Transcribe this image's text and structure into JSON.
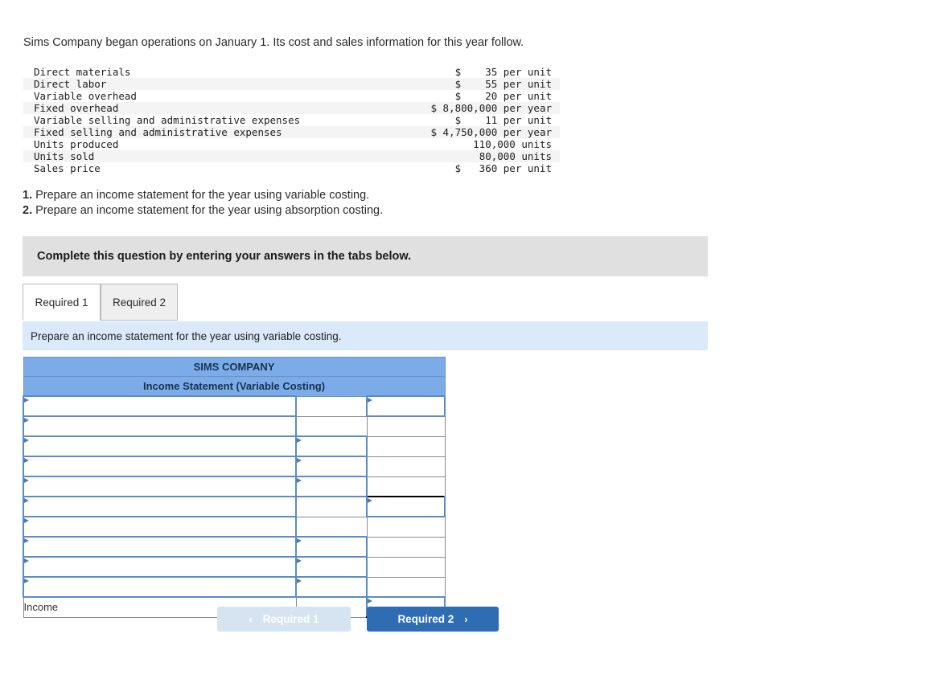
{
  "intro": "Sims Company began operations on January 1. Its cost and sales information for this year follow.",
  "facts": {
    "rows": [
      {
        "label": "Direct materials",
        "value": "$    35 per unit"
      },
      {
        "label": "Direct labor",
        "value": "$    55 per unit"
      },
      {
        "label": "Variable overhead",
        "value": "$    20 per unit"
      },
      {
        "label": "Fixed overhead",
        "value": "$ 8,800,000 per year"
      },
      {
        "label": "Variable selling and administrative expenses",
        "value": "$    11 per unit"
      },
      {
        "label": "Fixed selling and administrative expenses",
        "value": "$ 4,750,000 per year"
      },
      {
        "label": "Units produced",
        "value": "110,000 units"
      },
      {
        "label": "Units sold",
        "value": "80,000 units"
      },
      {
        "label": "Sales price",
        "value": "$   360 per unit"
      }
    ]
  },
  "requirements": [
    {
      "num": "1.",
      "text": " Prepare an income statement for the year using variable costing."
    },
    {
      "num": "2.",
      "text": " Prepare an income statement for the year using absorption costing."
    }
  ],
  "banner": {
    "text": "Complete this question by entering your answers in the tabs below."
  },
  "tabs": [
    {
      "label": "Required 1",
      "active": true
    },
    {
      "label": "Required 2",
      "active": false
    }
  ],
  "subbanner": {
    "text": "Prepare an income statement for the year using variable costing."
  },
  "worksheet": {
    "title": "SIMS COMPANY",
    "subtitle": "Income Statement (Variable Costing)",
    "last_row_label": "Income"
  },
  "nav": {
    "prev_label": "Required 1",
    "prev_icon": "chevron-left-icon",
    "prev_chevron": "‹",
    "next_label": "Required 2",
    "next_icon": "chevron-right-icon",
    "next_chevron": "›"
  },
  "colors": {
    "header_blue": "#7cace8",
    "cell_border_blue": "#5b8cc4",
    "subbanner_blue": "#dbeafa",
    "banner_gray": "#e0e0e0",
    "next_button_blue": "#2e6db4",
    "prev_button_blue": "#d6e4f2"
  }
}
